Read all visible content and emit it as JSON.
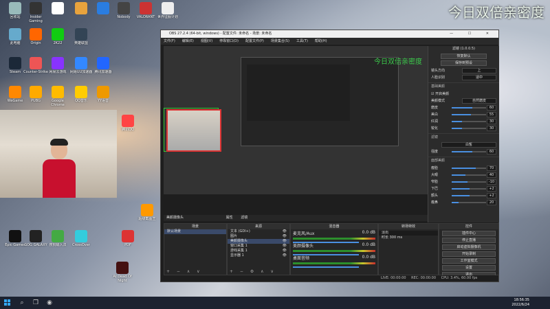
{
  "overlay_brand": "今日双倍亲密度",
  "desktop_icons": [
    {
      "label": "回收站",
      "color": "#9bb"
    },
    {
      "label": "Insider Gaming",
      "color": "#333"
    },
    {
      "label": "",
      "color": "#fff"
    },
    {
      "label": "",
      "color": "#e8a33d"
    },
    {
      "label": "",
      "color": "#2a7de1"
    },
    {
      "label": "Nobody",
      "color": "#444"
    },
    {
      "label": "VALORANT",
      "color": "#c33"
    },
    {
      "label": "世界征服计划",
      "color": "#eee"
    },
    {
      "label": "此电脑",
      "color": "#6ac"
    },
    {
      "label": "Origin",
      "color": "#f60"
    },
    {
      "label": "2K22",
      "color": "#1c1"
    },
    {
      "label": "英雄联盟",
      "color": "#345"
    },
    {
      "label": "Steam",
      "color": "#1b2838"
    },
    {
      "label": "Counter-Strike",
      "color": "#e55"
    },
    {
      "label": "网易云游戏",
      "color": "#83f"
    },
    {
      "label": "网易UU加速器",
      "color": "#38f"
    },
    {
      "label": "腾讯加速器",
      "color": "#26f"
    },
    {
      "label": "WeGame",
      "color": "#f80"
    },
    {
      "label": "PUBG",
      "color": "#fa0"
    },
    {
      "label": "Google Chrome",
      "color": "#fb0"
    },
    {
      "label": "QQ音乐",
      "color": "#fc0"
    },
    {
      "label": "YY语音",
      "color": "#e90"
    },
    {
      "label": "腾讯QQ",
      "color": "#f44"
    },
    {
      "label": "Epic Games",
      "color": "#111"
    },
    {
      "label": "GOG GALAXY",
      "color": "#222"
    },
    {
      "label": "搜狗输入法",
      "color": "#4a4"
    },
    {
      "label": "CrossOver",
      "color": "#3cd"
    },
    {
      "label": "PDF",
      "color": "#d33"
    },
    {
      "label": "超级截图王",
      "color": "#f90"
    },
    {
      "label": "At Dead Of Night",
      "color": "#411"
    }
  ],
  "obs": {
    "title": "OBS 27.2.4 (64-bit, windows) - 配置文件: 未命名 - 场景: 未命名",
    "window_buttons": "— ☐ ✕",
    "menu": [
      "文件(F)",
      "编辑(E)",
      "视图(V)",
      "停靠窗口(D)",
      "配置文件(P)",
      "场景集合(S)",
      "工具(T)",
      "帮助(H)"
    ],
    "preview_watermark": "今日双倍亲密度",
    "settings_panel": {
      "header": "滤镜 (1.0.0.5)",
      "buttons": [
        "恢复默认",
        "保存到预设"
      ],
      "dropdowns": [
        {
          "label": "镜头方向",
          "value": "上"
        },
        {
          "label": "人脸识别",
          "value": "适中"
        }
      ],
      "beauty_title": "基础美颜",
      "beauty_toggle": "开启美颜",
      "beauty_mode": {
        "label": "美颜模式",
        "value": "自然磨皮"
      },
      "beauty_sliders": [
        {
          "label": "磨皮",
          "value": "60",
          "level": 0.6
        },
        {
          "label": "美白",
          "value": "55",
          "level": 0.55
        },
        {
          "label": "红润",
          "value": "30",
          "level": 0.3
        },
        {
          "label": "锐化",
          "value": "30",
          "level": 0.3
        }
      ],
      "filter_title": "滤镜",
      "filter_value": "白皙",
      "filter_strength": {
        "label": "强度",
        "value": "60",
        "level": 0.6
      },
      "face_title": "面部美颜",
      "face_sliders": [
        {
          "label": "瘦脸",
          "value": "70",
          "level": 0.7
        },
        {
          "label": "大眼",
          "value": "40",
          "level": 0.4
        },
        {
          "label": "窄脸",
          "value": "-10",
          "level": 0.45
        },
        {
          "label": "下巴",
          "value": "+2",
          "level": 0.52
        },
        {
          "label": "额头",
          "value": "+2",
          "level": 0.52
        },
        {
          "label": "瘦鼻",
          "value": "20",
          "level": 0.2
        }
      ]
    },
    "source_toolbar": {
      "source_name": "美颜摄像头",
      "props": "属性",
      "filters": "滤镜"
    },
    "scenes": {
      "header": "场景",
      "items": [
        "默认场景"
      ]
    },
    "sources": {
      "header": "来源",
      "items": [
        "文本 (GDI+)",
        "图片",
        "美颜摄像头",
        "窗口采集 1",
        "游戏采集 1",
        "显示器 1"
      ]
    },
    "mixer": {
      "header": "混音器",
      "channels": [
        {
          "name": "麦克风/Aux",
          "db": "0.0 dB"
        },
        {
          "name": "美颜摄像头",
          "db": "0.0 dB"
        },
        {
          "name": "桌面音频",
          "db": "0.0 dB"
        }
      ]
    },
    "transitions": {
      "header": "转场特效",
      "type": "淡出",
      "duration_label": "时长",
      "duration": "300 ms"
    },
    "controls": {
      "header": "控件",
      "buttons": [
        "插件中心",
        "停止直播",
        "启动虚拟摄像机",
        "开始录制",
        "工作室模式",
        "设置",
        "退出"
      ]
    },
    "status": {
      "live": "LIVE: 00:00:00",
      "rec": "REC: 00:00:00",
      "cpu": "CPU: 3.4%, 60.00 fps"
    }
  },
  "taskbar": {
    "time": "18:56:35",
    "date": "2022/6/24"
  }
}
